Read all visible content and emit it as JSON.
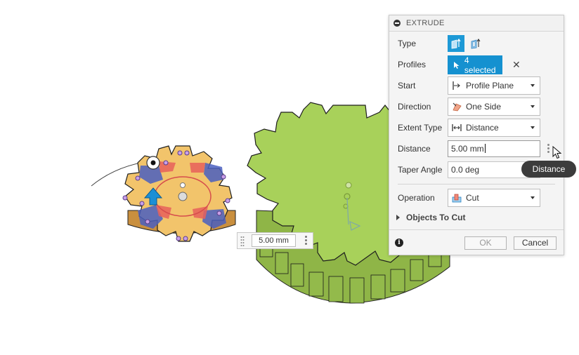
{
  "panel": {
    "title": "EXTRUDE",
    "rows": {
      "type": {
        "label": "Type"
      },
      "profiles": {
        "label": "Profiles",
        "value": "4 selected"
      },
      "start": {
        "label": "Start",
        "value": "Profile Plane"
      },
      "direction": {
        "label": "Direction",
        "value": "One Side"
      },
      "extent": {
        "label": "Extent Type",
        "value": "Distance"
      },
      "distance": {
        "label": "Distance",
        "value": "5.00 mm"
      },
      "taper": {
        "label": "Taper Angle",
        "value": "0.0 deg"
      },
      "operation": {
        "label": "Operation",
        "value": "Cut"
      }
    },
    "objects_to_cut": "Objects To Cut",
    "ok": "OK",
    "cancel": "Cancel",
    "clear_symbol": "✕"
  },
  "tooltip": "Distance",
  "dimension_input": "5.00 mm",
  "icons": {
    "collapse": "minus-circle-icon",
    "info": "info-icon",
    "cursor": "arrow-cursor-icon"
  },
  "colors": {
    "accent": "#1591d0",
    "gear_large": "#a8d15a",
    "gear_small": "#f2c46b",
    "profile_blue": "#4a5fbf",
    "profile_red": "#e8605a"
  }
}
